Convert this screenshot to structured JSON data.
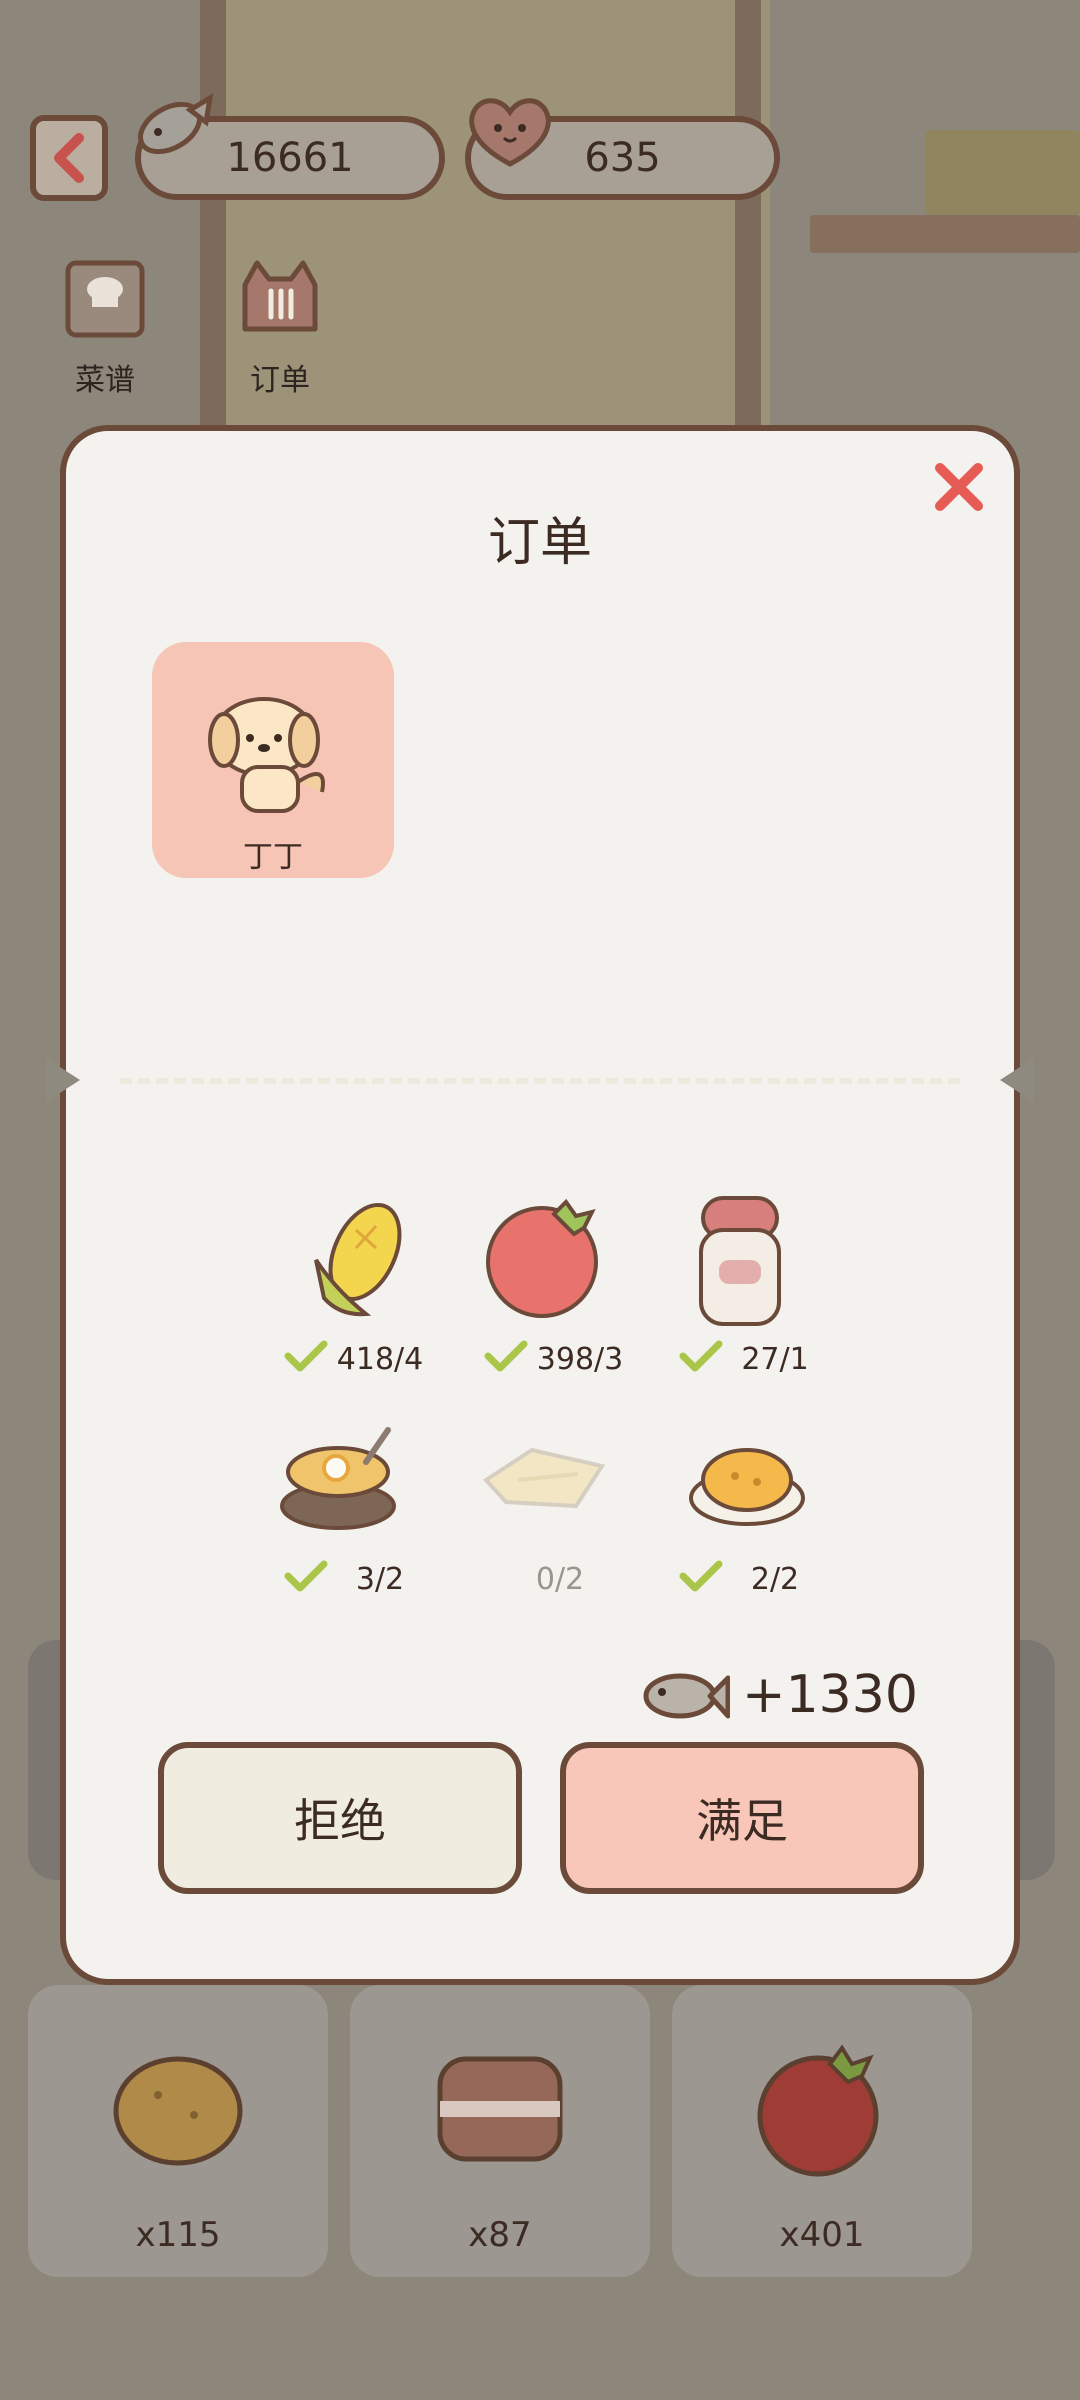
{
  "top_bar": {
    "fish_count": "16661",
    "heart_count": "635"
  },
  "side_menu": {
    "recipes_label": "菜谱",
    "orders_label": "订单"
  },
  "modal": {
    "title": "订单",
    "customer": {
      "name": "丁丁"
    },
    "ingredients": [
      {
        "icon": "corn-icon",
        "count": "418/4",
        "satisfied": true
      },
      {
        "icon": "tomato-icon",
        "count": "398/3",
        "satisfied": true
      },
      {
        "icon": "milk-bottle-icon",
        "count": "27/1",
        "satisfied": true
      },
      {
        "icon": "stone-pot-soup-icon",
        "count": "3/2",
        "satisfied": true
      },
      {
        "icon": "flatbread-icon",
        "count": "0/2",
        "satisfied": false
      },
      {
        "icon": "fried-rice-icon",
        "count": "2/2",
        "satisfied": true
      }
    ],
    "reward": "+1330",
    "reject_label": "拒绝",
    "satisfy_label": "满足"
  },
  "inventory": [
    {
      "icon": "potato-icon",
      "qty": "x115"
    },
    {
      "icon": "bacon-icon",
      "qty": "x87"
    },
    {
      "icon": "tomato-icon",
      "qty": "x401"
    }
  ]
}
